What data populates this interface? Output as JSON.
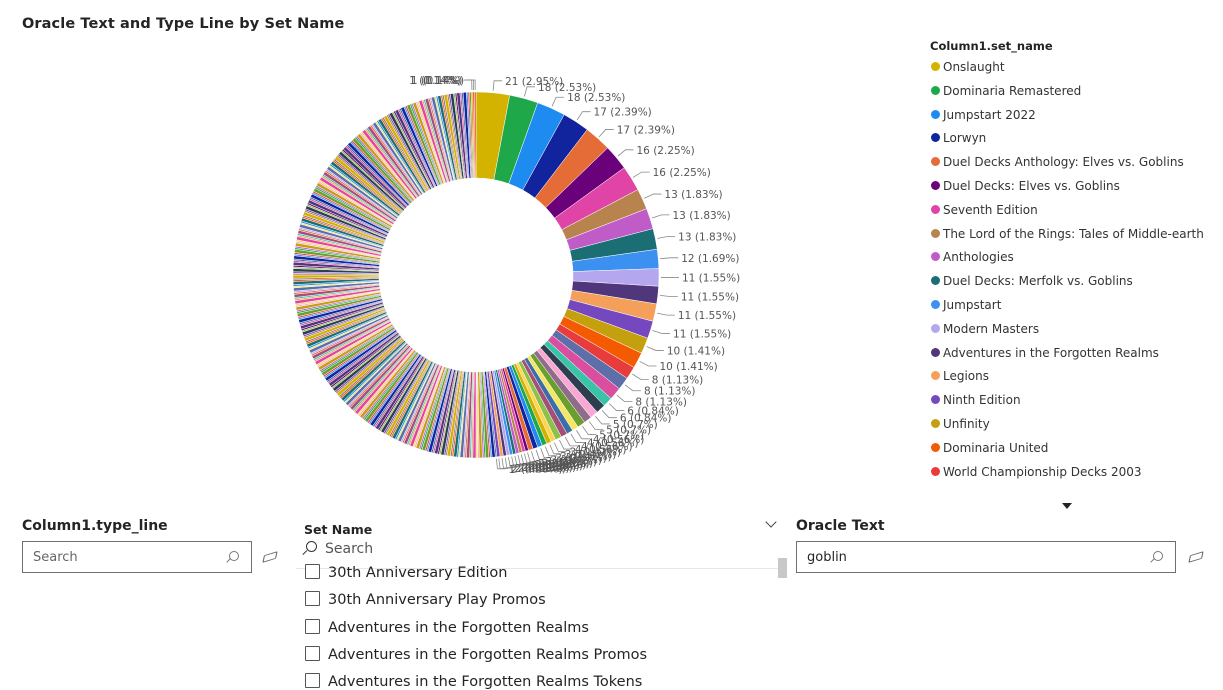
{
  "chart_title": "Oracle Text and Type Line by Set Name",
  "legend": {
    "title": "Column1.set_name",
    "items": [
      {
        "label": "Onslaught",
        "color": "#D4B200"
      },
      {
        "label": "Dominaria Remastered",
        "color": "#1EA84A"
      },
      {
        "label": "Jumpstart 2022",
        "color": "#1E8BF0"
      },
      {
        "label": "Lorwyn",
        "color": "#12239E"
      },
      {
        "label": "Duel Decks Anthology: Elves vs. Goblins",
        "color": "#E66C37"
      },
      {
        "label": "Duel Decks: Elves vs. Goblins",
        "color": "#6B007B"
      },
      {
        "label": "Seventh Edition",
        "color": "#E044A7"
      },
      {
        "label": "The Lord of the Rings: Tales of Middle-earth",
        "color": "#B8834E"
      },
      {
        "label": "Anthologies",
        "color": "#C05CC8"
      },
      {
        "label": "Duel Decks: Merfolk vs. Goblins",
        "color": "#1A6E74"
      },
      {
        "label": "Jumpstart",
        "color": "#3C90F0"
      },
      {
        "label": "Modern Masters",
        "color": "#B4A7F0"
      },
      {
        "label": "Adventures in the Forgotten Realms",
        "color": "#50367A"
      },
      {
        "label": "Legions",
        "color": "#F5A05A"
      },
      {
        "label": "Ninth Edition",
        "color": "#7548C0"
      },
      {
        "label": "Unfinity",
        "color": "#C4A00E"
      },
      {
        "label": "Dominaria United",
        "color": "#F45A00"
      },
      {
        "label": "World Championship Decks 2003",
        "color": "#E83C3C"
      }
    ]
  },
  "chart_data": {
    "type": "pie",
    "variant": "donut",
    "title": "Oracle Text and Type Line by Set Name",
    "legend_title": "Column1.set_name",
    "legend_position": "right",
    "labeled_slices": [
      {
        "label": "21 (2.95%)",
        "value": 21,
        "percent": 2.95
      },
      {
        "label": "18 (2.53%)",
        "value": 18,
        "percent": 2.53
      },
      {
        "label": "18 (2.53%)",
        "value": 18,
        "percent": 2.53
      },
      {
        "label": "17 (2.39%)",
        "value": 17,
        "percent": 2.39
      },
      {
        "label": "17 (2.39%)",
        "value": 17,
        "percent": 2.39
      },
      {
        "label": "16 (2.25%)",
        "value": 16,
        "percent": 2.25
      },
      {
        "label": "16 (2.25%)",
        "value": 16,
        "percent": 2.25
      },
      {
        "label": "13 (1.83%)",
        "value": 13,
        "percent": 1.83
      },
      {
        "label": "13 (1.83%)",
        "value": 13,
        "percent": 1.83
      },
      {
        "label": "13 (1.83%)",
        "value": 13,
        "percent": 1.83
      },
      {
        "label": "12 (1.69%)",
        "value": 12,
        "percent": 1.69
      },
      {
        "label": "11 (1.55%)",
        "value": 11,
        "percent": 1.55
      },
      {
        "label": "11 (1.55%)",
        "value": 11,
        "percent": 1.55
      },
      {
        "label": "11 (1.55%)",
        "value": 11,
        "percent": 1.55
      },
      {
        "label": "11 (1.55%)",
        "value": 11,
        "percent": 1.55
      },
      {
        "label": "10 (1.41%)",
        "value": 10,
        "percent": 1.41
      },
      {
        "label": "10 (1.41%)",
        "value": 10,
        "percent": 1.41
      },
      {
        "label": "8 (1.13%)",
        "value": 8,
        "percent": 1.13
      },
      {
        "label": "8 (1.13%)",
        "value": 8,
        "percent": 1.13
      },
      {
        "label": "8 (1.13%)",
        "value": 8,
        "percent": 1.13
      },
      {
        "label": "6 (0.84%)",
        "value": 6,
        "percent": 0.84
      },
      {
        "label": "6 (0.84%)",
        "value": 6,
        "percent": 0.84
      },
      {
        "label": "5 (0.7%)",
        "value": 5,
        "percent": 0.7
      },
      {
        "label": "5 (0.7%)",
        "value": 5,
        "percent": 0.7
      },
      {
        "label": "5 (0.7%)",
        "value": 5,
        "percent": 0.7
      },
      {
        "label": "4 (0.56%)",
        "value": 4,
        "percent": 0.56
      },
      {
        "label": "4 (0.56%)",
        "value": 4,
        "percent": 0.56
      },
      {
        "label": "4 (0.56%)",
        "value": 4,
        "percent": 0.56
      },
      {
        "label": "4 (0.56%)",
        "value": 4,
        "percent": 0.56
      },
      {
        "label": "3 (0.42%)",
        "value": 3,
        "percent": 0.42
      },
      {
        "label": "3 (0.42%)",
        "value": 3,
        "percent": 0.42
      },
      {
        "label": "3 (0.42%)",
        "value": 3,
        "percent": 0.42
      },
      {
        "label": "3 (0.42%)",
        "value": 3,
        "percent": 0.42
      },
      {
        "label": "3 (0.42%)",
        "value": 3,
        "percent": 0.42
      },
      {
        "label": "3 (0.42%)",
        "value": 3,
        "percent": 0.42
      },
      {
        "label": "2 (0.28%)",
        "value": 2,
        "percent": 0.28
      },
      {
        "label": "2 (0.28%)",
        "value": 2,
        "percent": 0.28
      },
      {
        "label": "2 (0.28%)",
        "value": 2,
        "percent": 0.28
      },
      {
        "label": "2 (0.28%)",
        "value": 2,
        "percent": 0.28
      },
      {
        "label": "2 (0.28%)",
        "value": 2,
        "percent": 0.28
      },
      {
        "label": "2 (0.28%)",
        "value": 2,
        "percent": 0.28
      },
      {
        "label": "2 (0.28%)",
        "value": 2,
        "percent": 0.28
      },
      {
        "label": "2 (0.28%)",
        "value": 2,
        "percent": 0.28
      },
      {
        "label": "2 (0.28%)",
        "value": 2,
        "percent": 0.28
      },
      {
        "label": "2 (0.28%)",
        "value": 2,
        "percent": 0.28
      },
      {
        "label": "1 (0.14%)",
        "value": 1,
        "percent": 0.14
      },
      {
        "label": "1 (0.14%)",
        "value": 1,
        "percent": 0.14
      },
      {
        "label": "(0.14%)",
        "value": 1,
        "percent": 0.14
      },
      {
        "label": "1",
        "value": 1,
        "percent": 0.14
      }
    ],
    "palette": [
      "#D4B200",
      "#1EA84A",
      "#1E8BF0",
      "#12239E",
      "#E66C37",
      "#6B007B",
      "#E044A7",
      "#B8834E",
      "#C05CC8",
      "#1A6E74",
      "#3C90F0",
      "#B4A7F0",
      "#50367A",
      "#F5A05A",
      "#7548C0",
      "#C4A00E",
      "#F45A00",
      "#E83C3C",
      "#5E6EA8",
      "#D94E9E",
      "#39C4A8",
      "#2C3E50",
      "#F9A8D4",
      "#8E6C8A",
      "#6A9E2E",
      "#F5E663",
      "#3A6EA5",
      "#A64D79",
      "#8BC34A",
      "#FFD54F"
    ]
  },
  "type_slicer": {
    "title": "Column1.type_line",
    "placeholder": "Search"
  },
  "set_slicer": {
    "title": "Set Name",
    "search_placeholder": "Search",
    "items": [
      "30th Anniversary Edition",
      "30th Anniversary Play Promos",
      "Adventures in the Forgotten Realms",
      "Adventures in the Forgotten Realms Promos",
      "Adventures in the Forgotten Realms Tokens"
    ]
  },
  "oracle_slicer": {
    "title": "Oracle Text",
    "value": "goblin"
  }
}
